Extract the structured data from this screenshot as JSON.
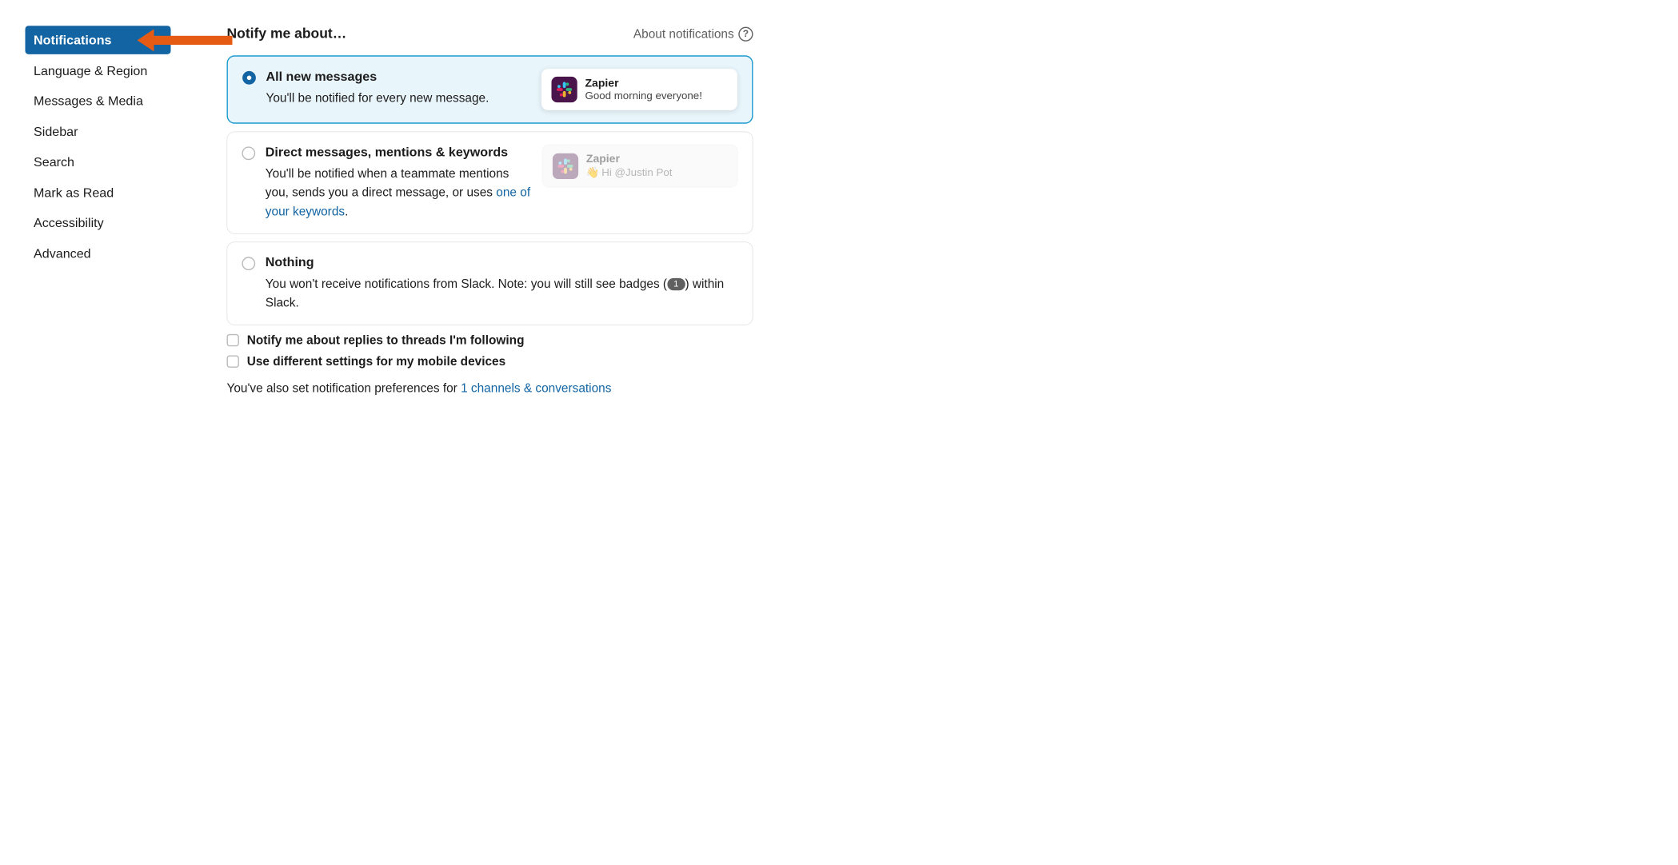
{
  "sidebar": {
    "items": [
      {
        "label": "Notifications",
        "active": true
      },
      {
        "label": "Language & Region",
        "active": false
      },
      {
        "label": "Messages & Media",
        "active": false
      },
      {
        "label": "Sidebar",
        "active": false
      },
      {
        "label": "Search",
        "active": false
      },
      {
        "label": "Mark as Read",
        "active": false
      },
      {
        "label": "Accessibility",
        "active": false
      },
      {
        "label": "Advanced",
        "active": false
      }
    ]
  },
  "header": {
    "title": "Notify me about…",
    "about_label": "About notifications",
    "help_glyph": "?"
  },
  "options": {
    "all": {
      "title": "All new messages",
      "desc": "You'll be notified for every new message.",
      "preview_title": "Zapier",
      "preview_msg": "Good morning everyone!"
    },
    "dm": {
      "title": "Direct messages, mentions & keywords",
      "desc_prefix": "You'll be notified when a teammate mentions you, sends you a direct message, or uses ",
      "desc_link": "one of your keywords",
      "desc_suffix": ".",
      "preview_title": "Zapier",
      "preview_wave": "👋",
      "preview_msg": "Hi @Justin Pot"
    },
    "nothing": {
      "title": "Nothing",
      "desc_prefix": "You won't receive notifications from Slack. Note: you will still see badges (",
      "badge": "1",
      "desc_suffix": ") within Slack."
    }
  },
  "checkboxes": {
    "threads": "Notify me about replies to threads I'm following",
    "mobile": "Use different settings for my mobile devices"
  },
  "footer": {
    "prefix": "You've also set notification preferences for ",
    "link": "1 channels & conversations"
  }
}
